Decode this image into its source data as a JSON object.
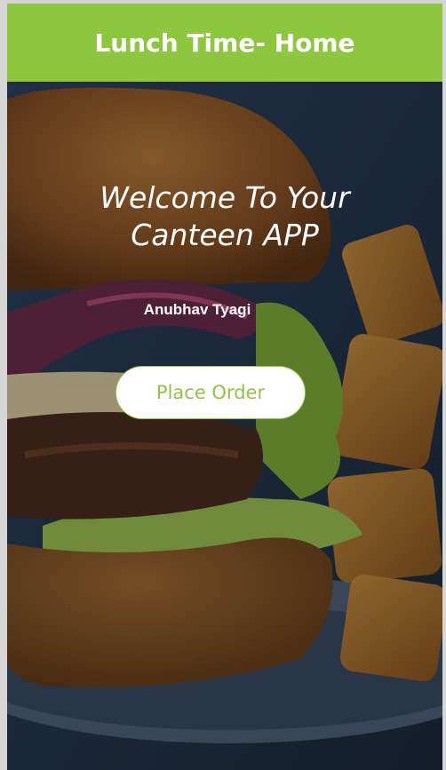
{
  "header": {
    "title": "Lunch Time- Home"
  },
  "hero": {
    "welcome_line1": "Welcome To Your",
    "welcome_line2": "Canteen APP",
    "user_name": "Anubhav Tyagi",
    "place_order_label": "Place Order"
  },
  "colors": {
    "accent": "#8dc63f",
    "text_on_image": "#ffffff"
  }
}
